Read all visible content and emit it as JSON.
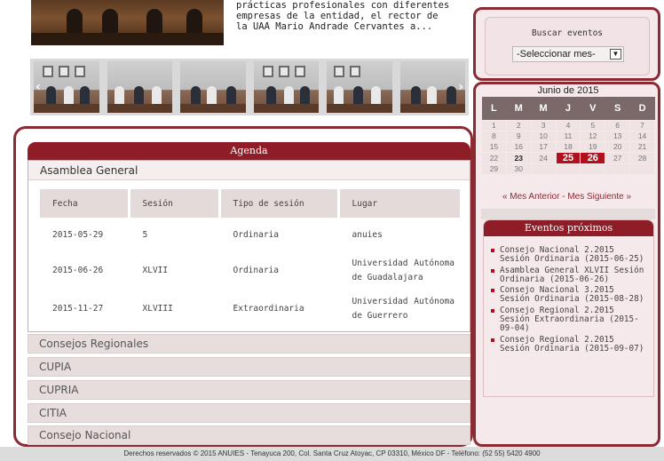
{
  "news": {
    "text": "prácticas profesionales con diferentes empresas de la entidad, el rector de la UAA Mario Andrade Cervantes a..."
  },
  "agenda": {
    "header": "Agenda",
    "section_title": "Asamblea General",
    "columns": [
      "Fecha",
      "Sesión",
      "Tipo de sesión",
      "Lugar"
    ],
    "rows": [
      {
        "fecha": "2015-05-29",
        "sesion": "5",
        "tipo": "Ordinaria",
        "lugar": "anuies"
      },
      {
        "fecha": "2015-06-26",
        "sesion": "XLVII",
        "tipo": "Ordinaria",
        "lugar": "Universidad Autónoma de Guadalajara"
      },
      {
        "fecha": "2015-11-27",
        "sesion": "XLVIII",
        "tipo": "Extraordinaria",
        "lugar": "Universidad Autónoma de Guerrero"
      }
    ],
    "accordion": [
      "Consejos Regionales",
      "CUPIA",
      "CUPRIA",
      "CITIA",
      "Consejo Nacional"
    ]
  },
  "search": {
    "title": "Buscar eventos",
    "select_value": "-Seleccionar mes-"
  },
  "calendar": {
    "title": "Junio de 2015",
    "weekdays": [
      "L",
      "M",
      "M",
      "J",
      "V",
      "S",
      "D"
    ],
    "weeks": [
      [
        "1",
        "2",
        "3",
        "4",
        "5",
        "6",
        "7"
      ],
      [
        "8",
        "9",
        "10",
        "11",
        "12",
        "13",
        "14"
      ],
      [
        "15",
        "16",
        "17",
        "18",
        "19",
        "20",
        "21"
      ],
      [
        "22",
        "23",
        "24",
        "25",
        "26",
        "27",
        "28"
      ],
      [
        "29",
        "30",
        "",
        "",
        "",
        "",
        ""
      ]
    ],
    "today": "23",
    "event_days": [
      "25",
      "26"
    ],
    "prev_label": "« Mes Anterior",
    "separator": "-",
    "next_label": "Mes Siguiente »"
  },
  "upcoming": {
    "header": "Eventos próximos",
    "items": [
      "Consejo Nacional 2.2015 Sesión Ordinaria (2015-06-25)",
      "Asamblea General XLVII Sesión Ordinaria (2015-06-26)",
      "Consejo Nacional 3.2015 Sesión Ordinaria (2015-08-28)",
      "Consejo Regional 2.2015 Sesión Extraordinaria (2015-09-04)",
      "Consejo Regional 2.2015 Sesión Ordinaria (2015-09-07)"
    ]
  },
  "footer": {
    "text": "Derechos reservados © 2015 ANUIES - Tenayuca 200, Col. Santa Cruz Atoyac, CP 03310, México DF - Teléfono: (52 55) 5420 4900"
  },
  "colors": {
    "brand": "#8e1d27",
    "event_day": "#b0111d",
    "panel_bg": "#f6e9eb"
  }
}
